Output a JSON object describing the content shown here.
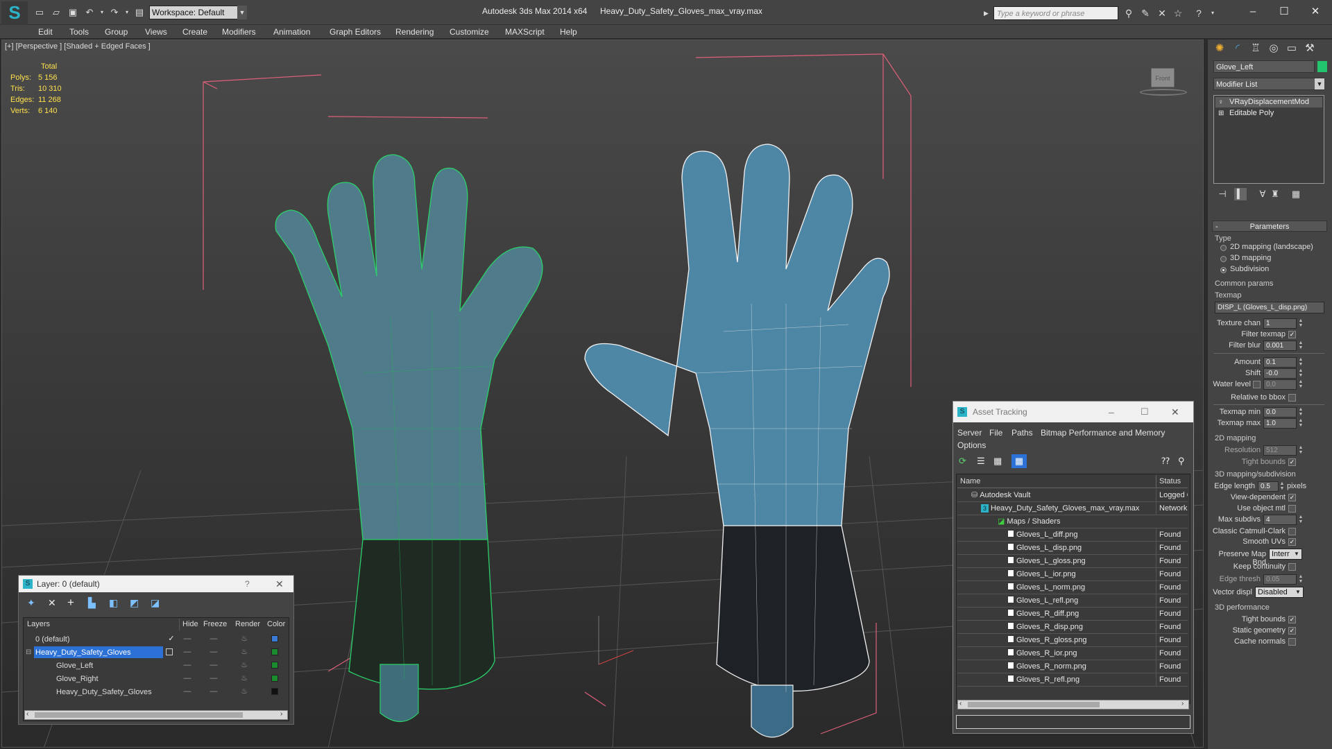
{
  "titlebar": {
    "workspace": "Workspace: Default",
    "app_title": "Autodesk 3ds Max  2014 x64",
    "doc_title": "Heavy_Duty_Safety_Gloves_max_vray.max",
    "search_placeholder": "Type a keyword or phrase"
  },
  "menu": [
    "Edit",
    "Tools",
    "Group",
    "Views",
    "Create",
    "Modifiers",
    "Animation",
    "Graph Editors",
    "Rendering",
    "Customize",
    "MAXScript",
    "Help"
  ],
  "viewport": {
    "label": "[+] [Perspective ] [Shaded + Edged Faces ]",
    "stats": {
      "header": "Total",
      "polys_label": "Polys:",
      "polys": "5 156",
      "tris_label": "Tris:",
      "tris": "10 310",
      "edges_label": "Edges:",
      "edges": "11 268",
      "verts_label": "Verts:",
      "verts": "6 140"
    },
    "viewcube_label": "Front"
  },
  "command_panel": {
    "object_name": "Glove_Left",
    "object_color": "#22c46e",
    "modifier_list": "Modifier List",
    "stack": [
      "VRayDisplacementMod",
      "Editable Poly"
    ],
    "rollout_title": "Parameters",
    "type_label": "Type",
    "type_options": [
      "2D mapping (landscape)",
      "3D mapping",
      "Subdivision"
    ],
    "common_params": "Common params",
    "texmap_label": "Texmap",
    "texmap_value": "DISP_L (Gloves_L_disp.png)",
    "texture_chan_label": "Texture chan",
    "texture_chan": "1",
    "filter_texmap_label": "Filter texmap",
    "filter_blur_label": "Filter blur",
    "filter_blur": "0.001",
    "amount_label": "Amount",
    "amount": "0.1",
    "shift_label": "Shift",
    "shift": "-0.0",
    "water_level_label": "Water level",
    "water_level": "0.0",
    "relative_bbox_label": "Relative to bbox",
    "texmap_min_label": "Texmap min",
    "texmap_min": "0.0",
    "texmap_max_label": "Texmap max",
    "texmap_max": "1.0",
    "mapping2d_label": "2D mapping",
    "resolution_label": "Resolution",
    "resolution": "512",
    "tight_bounds_label": "Tight bounds",
    "mapping3d_label": "3D mapping/subdivision",
    "edge_length_label": "Edge length",
    "edge_length": "0.5",
    "pixels_label": "pixels",
    "view_dependent_label": "View-dependent",
    "use_object_mtl_label": "Use object mtl",
    "max_subdivs_label": "Max subdivs",
    "max_subdivs": "4",
    "classic_cc_label": "Classic Catmull-Clark",
    "smooth_uvs_label": "Smooth UVs",
    "preserve_map_label": "Preserve Map Bnd",
    "preserve_map": "Interr",
    "keep_continuity_label": "Keep continuity",
    "edge_thresh_label": "Edge thresh",
    "edge_thresh": "0.05",
    "vector_displ_label": "Vector displ",
    "vector_displ": "Disabled",
    "perf_label": "3D performance",
    "tight_bounds2_label": "Tight bounds",
    "static_geometry_label": "Static geometry",
    "cache_normals_label": "Cache normals"
  },
  "layer_window": {
    "title": "Layer: 0 (default)",
    "help": "?",
    "columns": [
      "Layers",
      "Hide",
      "Freeze",
      "Render",
      "Color"
    ],
    "rows": [
      {
        "name": "0 (default)",
        "color": "#3a7bd5"
      },
      {
        "name": "Heavy_Duty_Safety_Gloves",
        "color": "#1b8c2e"
      },
      {
        "name": "Glove_Left",
        "color": "#1b8c2e"
      },
      {
        "name": "Glove_Right",
        "color": "#1b8c2e"
      },
      {
        "name": "Heavy_Duty_Safety_Gloves",
        "color": "#111111"
      }
    ]
  },
  "asset_window": {
    "title": "Asset Tracking",
    "menu": [
      "Server",
      "File",
      "Paths",
      "Bitmap Performance and Memory",
      "Options"
    ],
    "col_name": "Name",
    "col_status": "Status",
    "rows": [
      {
        "name": "Autodesk Vault",
        "status": "Logged Out"
      },
      {
        "name": "Heavy_Duty_Safety_Gloves_max_vray.max",
        "status": "Network"
      },
      {
        "name": "Maps / Shaders",
        "status": ""
      },
      {
        "name": "Gloves_L_diff.png",
        "status": "Found"
      },
      {
        "name": "Gloves_L_disp.png",
        "status": "Found"
      },
      {
        "name": "Gloves_L_gloss.png",
        "status": "Found"
      },
      {
        "name": "Gloves_L_ior.png",
        "status": "Found"
      },
      {
        "name": "Gloves_L_norm.png",
        "status": "Found"
      },
      {
        "name": "Gloves_L_refl.png",
        "status": "Found"
      },
      {
        "name": "Gloves_R_diff.png",
        "status": "Found"
      },
      {
        "name": "Gloves_R_disp.png",
        "status": "Found"
      },
      {
        "name": "Gloves_R_gloss.png",
        "status": "Found"
      },
      {
        "name": "Gloves_R_ior.png",
        "status": "Found"
      },
      {
        "name": "Gloves_R_norm.png",
        "status": "Found"
      },
      {
        "name": "Gloves_R_refl.png",
        "status": "Found"
      }
    ]
  }
}
